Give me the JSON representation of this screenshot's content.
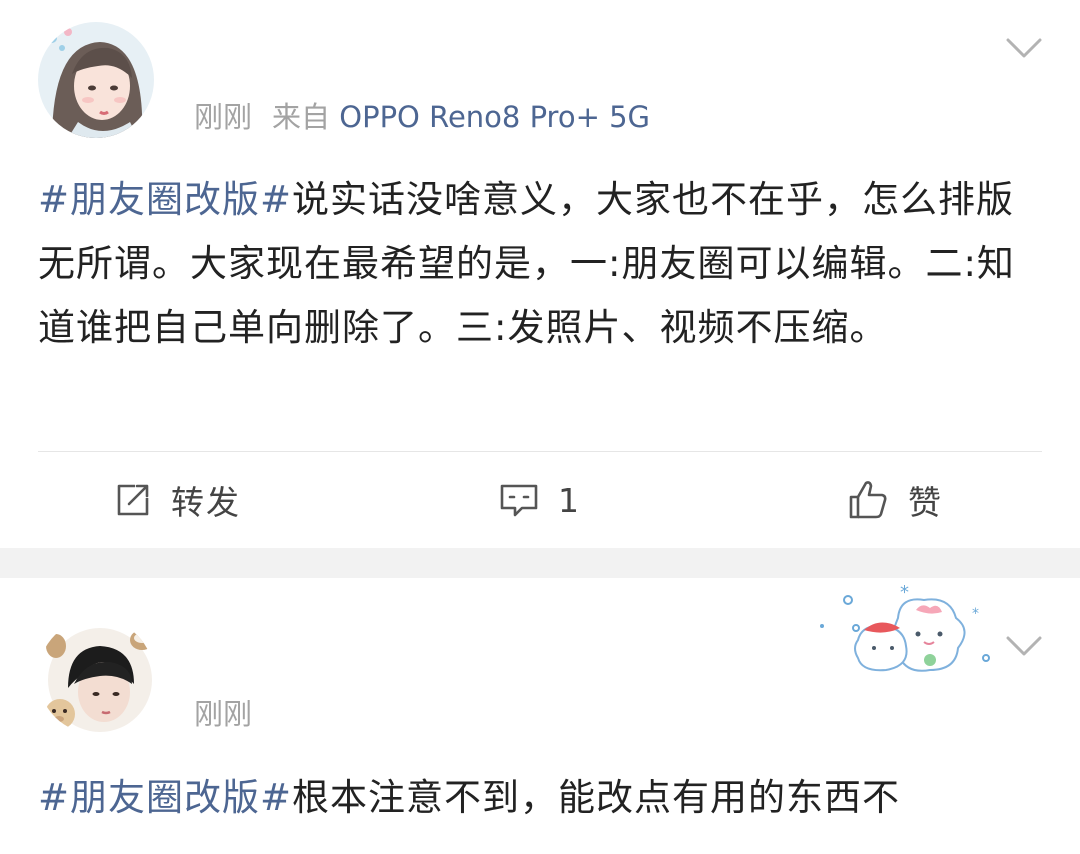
{
  "posts": [
    {
      "time": "刚刚",
      "source_prefix": "来自",
      "source_device": "OPPO Reno8 Pro+ 5G",
      "hashtag": "#朋友圈改版#",
      "text": "说实话没啥意义，大家也不在乎，怎么排版无所谓。大家现在最希望的是，一:朋友圈可以编辑。二:知道谁把自己单向删除了。三:发照片、视频不压缩。",
      "actions": {
        "repost": "转发",
        "comment": "1",
        "like": "赞"
      }
    },
    {
      "time": "刚刚",
      "hashtag": "#朋友圈改版#",
      "text": "根本注意不到，能改点有用的东西不"
    }
  ],
  "icons": {
    "more": "chevron-down-icon",
    "repost": "share-square-icon",
    "comment": "comment-bubble-icon",
    "like": "thumbs-up-icon"
  },
  "colors": {
    "link": "#4d6692",
    "meta": "#a3a3a3",
    "text": "#222222",
    "separator": "#f2f2f2"
  }
}
